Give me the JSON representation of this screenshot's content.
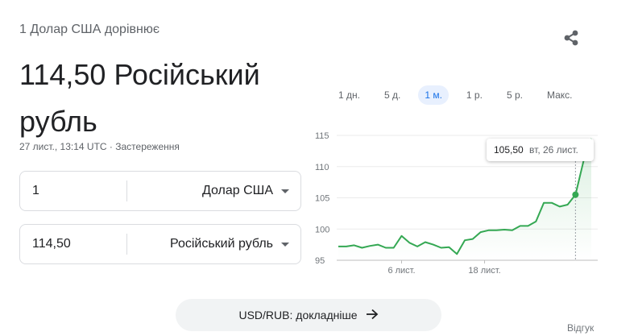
{
  "header": {
    "subtitle": "1 Долар США дорівнює",
    "result": "114,50 Російський рубль",
    "meta": "27 лист., 13:14 UTC · Застереження"
  },
  "converter": {
    "from_amount": "1",
    "from_currency": "Долар США",
    "to_amount": "114,50",
    "to_currency": "Російський рубль"
  },
  "ranges": {
    "items": [
      "1 дн.",
      "5 д.",
      "1 м.",
      "1 р.",
      "5 р.",
      "Макс."
    ],
    "active_index": 2
  },
  "tooltip": {
    "value": "105,50",
    "day": "вт, 26 лист."
  },
  "chart_data": {
    "type": "line",
    "x_tick_labels": [
      "6 лист.",
      "18 лист."
    ],
    "y_tick_labels": [
      "115",
      "110",
      "105",
      "100",
      "95"
    ],
    "ylim": [
      95,
      115
    ],
    "grid": true,
    "line_color": "#34a853",
    "highlight_index": 33,
    "series": [
      {
        "values": [
          97.2,
          97.2,
          97.4,
          97.0,
          97.3,
          97.5,
          97.0,
          97.0,
          98.9,
          97.8,
          97.2,
          97.9,
          97.5,
          97.0,
          97.1,
          96.0,
          98.2,
          98.4,
          99.5,
          99.8,
          99.8,
          99.9,
          99.8,
          100.5,
          100.5,
          101.2,
          104.2,
          104.2,
          103.6,
          103.9,
          105.5,
          110.8,
          114.5
        ]
      }
    ]
  },
  "actions": {
    "details_label": "USD/RUB: докладніше",
    "feedback": "Відгук"
  },
  "icons": {
    "share": "share-icon",
    "arrow": "arrow-right-icon"
  }
}
